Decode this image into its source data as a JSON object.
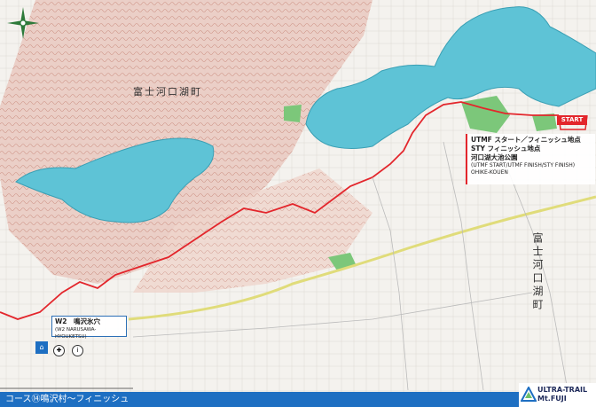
{
  "labels": {
    "town_horizontal": "富士河口湖町",
    "town_vertical": "富士河口湖町"
  },
  "start_point": {
    "flag": "START",
    "line1": "UTMF スタート／フィニッシュ地点",
    "line2": "STY フィニッシュ地点",
    "line3": "河口湖大池公園",
    "line4": "(UTMF START/UTMF FINISH/STY FINISH)",
    "line5": "OHIKE-KOUEN"
  },
  "w2_point": {
    "title": "W2　鳴沢氷穴",
    "subtitle": "(W2 NARUSAWA-HYOUKETSU)",
    "icons": [
      "water-icon",
      "info-icon"
    ]
  },
  "footer": {
    "title": "コース⑭鳴沢村〜フィニッシュ"
  },
  "logo": {
    "line1": "ULTRA-TRAIL",
    "line2": "Mt.FUJI"
  },
  "colors": {
    "route": "#e3262c",
    "lake": "#5ec3d6",
    "terrain": "#c98a7d",
    "footer": "#1e6fc2",
    "road": "#e0dc7a"
  }
}
